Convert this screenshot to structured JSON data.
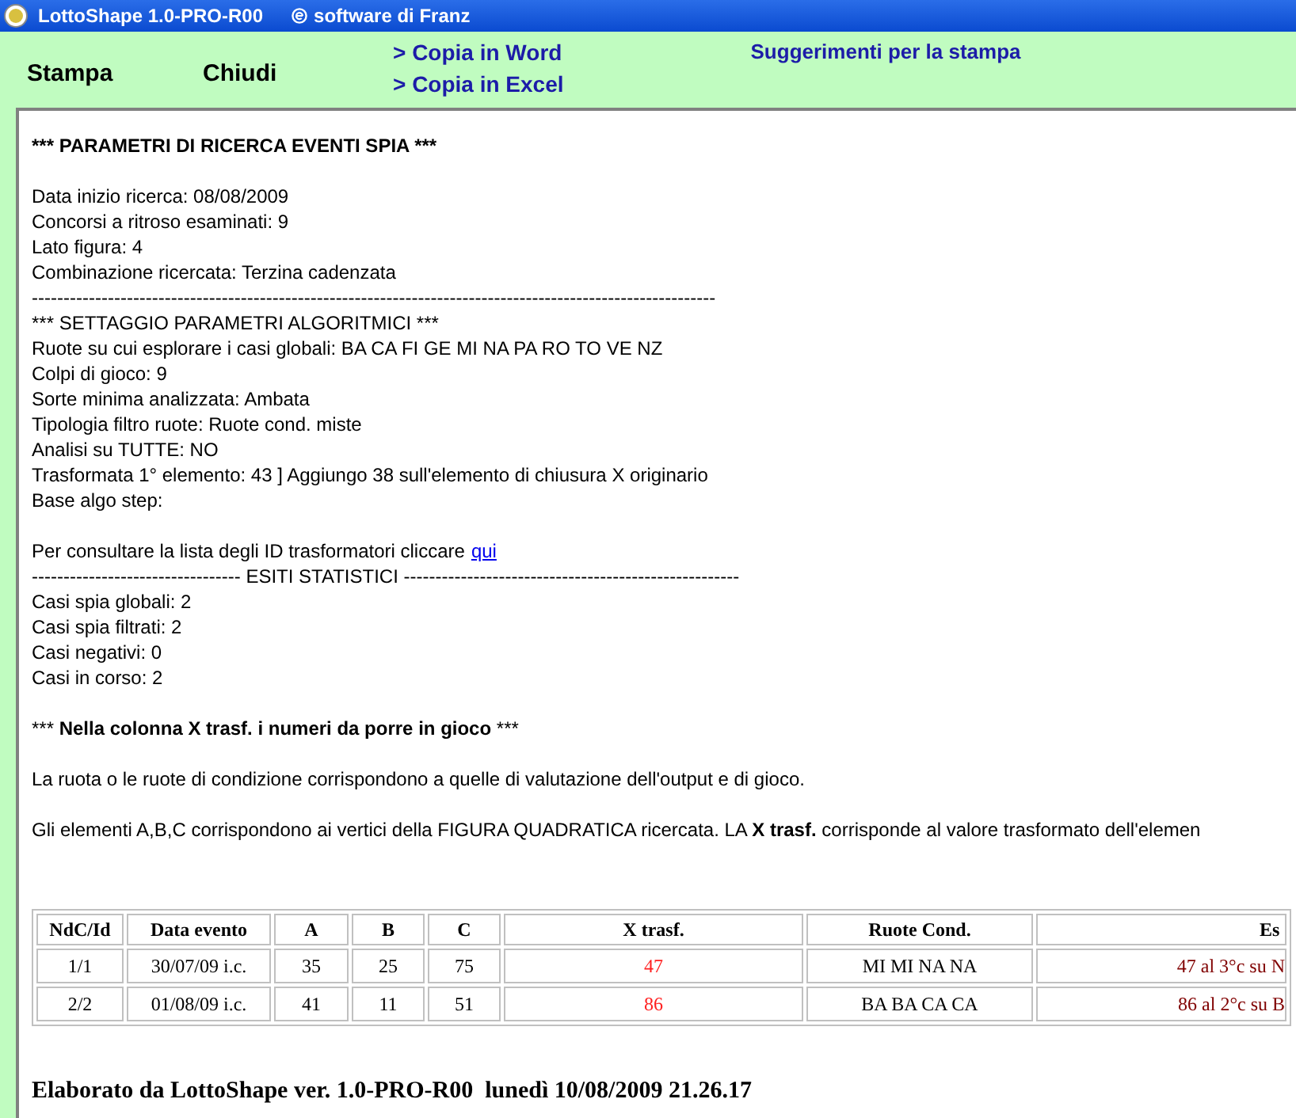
{
  "title_bar": {
    "app": "LottoShape 1.0-PRO-R00",
    "credit": "software di Franz"
  },
  "toolbar": {
    "buttons": [
      "Stampa",
      "Chiudi"
    ],
    "links": [
      "> Copia in Word",
      "> Copia in Excel"
    ],
    "hint_link": "Suggerimenti per la stampa"
  },
  "report": {
    "lines": [
      {
        "kind": "bold",
        "text": "*** PARAMETRI DI RICERCA EVENTI SPIA ***"
      },
      {
        "kind": "blank"
      },
      {
        "kind": "text",
        "text": "Data inizio ricerca: 08/08/2009"
      },
      {
        "kind": "text",
        "text": "Concorsi a ritroso esaminati: 9"
      },
      {
        "kind": "text",
        "text": "Lato figura: 4"
      },
      {
        "kind": "text",
        "text": "Combinazione ricercata: Terzina cadenzata"
      },
      {
        "kind": "text",
        "text": "------------------------------------------------------------------------------------------------------------"
      },
      {
        "kind": "text",
        "text": "*** SETTAGGIO PARAMETRI ALGORITMICI ***"
      },
      {
        "kind": "text",
        "text": "Ruote su cui esplorare i casi globali: BA CA FI GE MI NA PA RO TO VE NZ"
      },
      {
        "kind": "text",
        "text": "Colpi di gioco: 9"
      },
      {
        "kind": "text",
        "text": "Sorte minima analizzata: Ambata"
      },
      {
        "kind": "text",
        "text": "Tipologia filtro ruote: Ruote cond. miste"
      },
      {
        "kind": "text",
        "text": "Analisi su TUTTE: NO"
      },
      {
        "kind": "text",
        "text": "Trasformata 1° elemento: 43 ] Aggiungo 38 sull'elemento di chiusura X originario"
      },
      {
        "kind": "text",
        "text": "Base algo step:"
      },
      {
        "kind": "blank"
      },
      {
        "kind": "link",
        "text": "Per consultare la lista degli ID trasformatori cliccare",
        "link": "qui"
      },
      {
        "kind": "text",
        "text": "--------------------------------- ESITI STATISTICI -----------------------------------------------------"
      },
      {
        "kind": "text",
        "text": "Casi spia globali: 2"
      },
      {
        "kind": "text",
        "text": "Casi spia filtrati: 2"
      },
      {
        "kind": "text",
        "text": "Casi negativi: 0"
      },
      {
        "kind": "text",
        "text": "Casi in corso: 2"
      },
      {
        "kind": "blank"
      },
      {
        "kind": "parts",
        "parts": [
          {
            "text": "*** ",
            "bold": false
          },
          {
            "text": "Nella colonna X trasf. i numeri da porre in gioco",
            "bold": true
          },
          {
            "text": " ***",
            "bold": false
          }
        ]
      },
      {
        "kind": "blank"
      },
      {
        "kind": "text",
        "text": "La ruota o le ruote di condizione corrispondono a quelle di valutazione dell'output e di gioco."
      },
      {
        "kind": "blank"
      },
      {
        "kind": "parts",
        "parts": [
          {
            "text": "Gli elementi A,B,C corrispondono ai vertici della FIGURA QUADRATICA ricercata. LA ",
            "bold": false
          },
          {
            "text": "X trasf.",
            "bold": true
          },
          {
            "text": " corrisponde al valore trasformato dell'elemen",
            "bold": false
          }
        ]
      }
    ]
  },
  "table": {
    "columns": [
      "NdC/Id",
      "Data evento",
      "A",
      "B",
      "C",
      "X trasf.",
      "Ruote Cond.",
      "Es"
    ],
    "rows": [
      [
        "1/1",
        "30/07/09 i.c.",
        "35",
        "25",
        "75",
        "47",
        "MI MI NA NA",
        "47 al 3°c su N"
      ],
      [
        "2/2",
        "01/08/09 i.c.",
        "41",
        "11",
        "51",
        "86",
        "BA BA CA CA",
        "86 al 2°c su B"
      ]
    ]
  },
  "footer": "Elaborato da LottoShape ver. 1.0-PRO-R00  lunedì 10/08/2009 21.26.17"
}
